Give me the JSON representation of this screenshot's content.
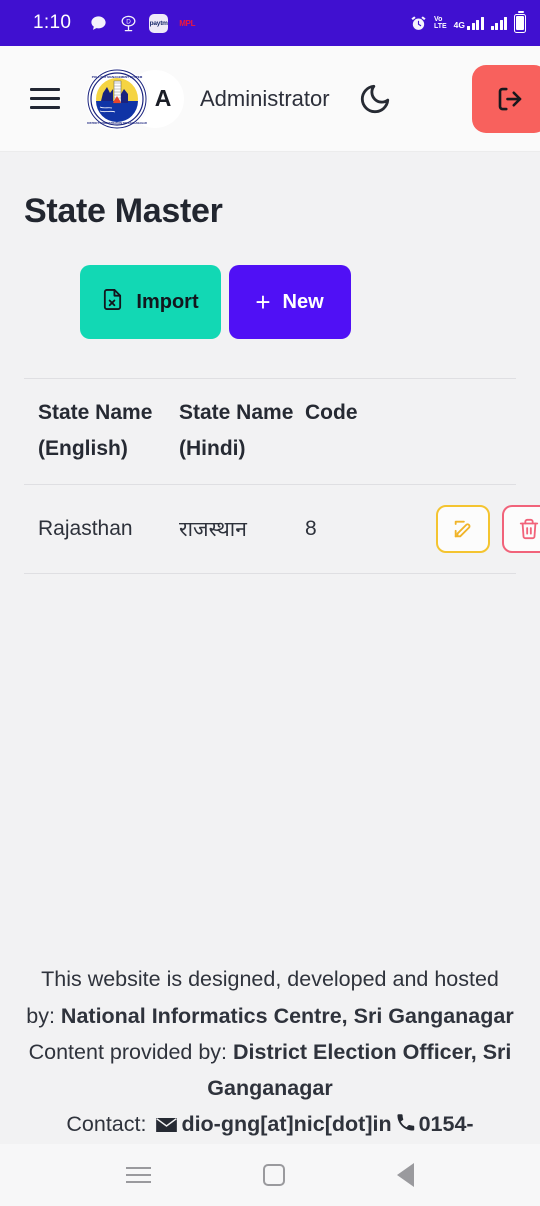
{
  "status_bar": {
    "time": "1:10",
    "left_icons": [
      "chat-bubble-icon",
      "dream11-icon",
      "paytm-icon",
      "mpl-icon"
    ],
    "paytm_label": "paytm",
    "mpl_label": "MPL",
    "alarm_icon": "alarm-clock-icon",
    "volte_top": "Vo",
    "volte_bottom": "LTE",
    "network_type": "4G",
    "battery_icon": "battery-icon",
    "background_color": "#4010d0"
  },
  "header": {
    "menu_icon": "hamburger-menu-icon",
    "logo_alt": "poll-day-management-system-emblem",
    "avatar_initial": "A",
    "user_name": "Administrator",
    "theme_toggle_icon": "moon-icon",
    "logout_icon": "logout-icon",
    "logout_color": "#f8615d"
  },
  "main": {
    "page_title": "State Master",
    "import_button": {
      "label": "Import",
      "icon": "file-excel-icon",
      "color": "#12d8b4"
    },
    "new_button": {
      "label": "New",
      "icon": "plus-icon",
      "color": "#5010f5"
    }
  },
  "table": {
    "columns": [
      "State Name (English)",
      "State Name (Hindi)",
      "Code",
      ""
    ],
    "rows": [
      {
        "state_name_english": "Rajasthan",
        "state_name_hindi": "राजस्थान",
        "code": "8",
        "edit_icon": "edit-pencil-icon",
        "delete_icon": "trash-icon"
      }
    ]
  },
  "footer": {
    "line1_prefix": "This website is designed, developed and hosted",
    "line2_prefix": "by: ",
    "line2_bold": "National Informatics Centre, Sri Ganganagar",
    "line3_prefix": "Content provided by: ",
    "line3_bold": "District Election Officer, Sri",
    "line4_bold": "Ganganagar",
    "line5_prefix": "Contact: ",
    "email": "dio-gng[at]nic[dot]in",
    "phone": "0154-",
    "email_icon": "envelope-icon",
    "phone_icon": "phone-icon"
  },
  "nav_bar": {
    "recents_icon": "recents-icon",
    "home_icon": "home-square-icon",
    "back_icon": "back-triangle-icon"
  }
}
